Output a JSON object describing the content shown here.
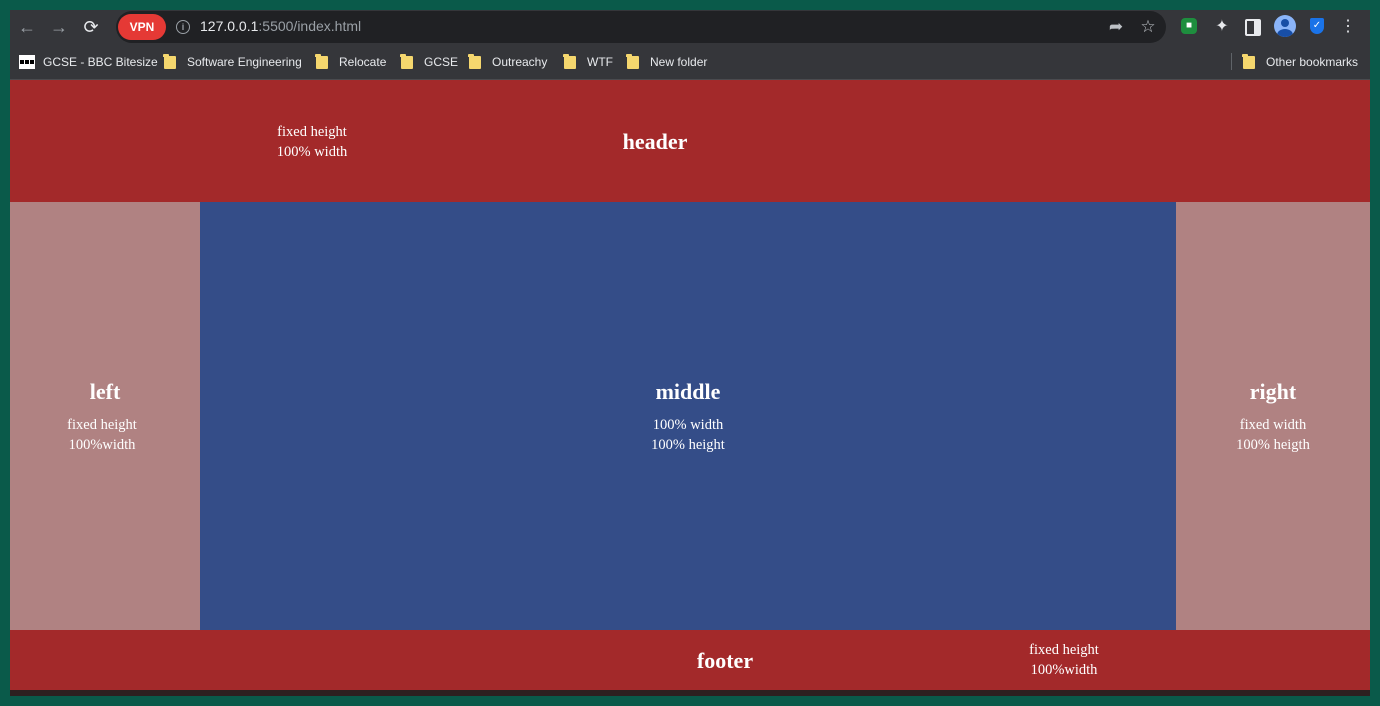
{
  "browser": {
    "vpn_label": "VPN",
    "url_host": "127.0.0.1",
    "url_path": ":5500/index.html"
  },
  "bookmarks": [
    {
      "label": "GCSE - BBC Bitesize",
      "icon": "bbc-icon"
    },
    {
      "label": "Software Engineering",
      "icon": "folder-icon"
    },
    {
      "label": "Relocate",
      "icon": "folder-icon"
    },
    {
      "label": "GCSE",
      "icon": "folder-icon"
    },
    {
      "label": "Outreachy",
      "icon": "folder-icon"
    },
    {
      "label": "WTF",
      "icon": "folder-icon"
    },
    {
      "label": "New folder",
      "icon": "folder-icon"
    }
  ],
  "other_bookmarks": "Other bookmarks",
  "page": {
    "header": {
      "title": "header",
      "note_line1": "fixed height",
      "note_line2": "100% width"
    },
    "left": {
      "title": "left",
      "note_line1": "fixed height",
      "note_line2": "100%width"
    },
    "middle": {
      "title": "middle",
      "note_line1": "100% width",
      "note_line2": "100% height"
    },
    "right": {
      "title": "right",
      "note_line1": "fixed width",
      "note_line2": "100% heigth"
    },
    "footer": {
      "title": "footer",
      "note_line1": "fixed height",
      "note_line2": "100%width"
    }
  },
  "colors": {
    "header_footer": "#a3292a",
    "sidebars": "#b08282",
    "middle": "#344d88"
  }
}
